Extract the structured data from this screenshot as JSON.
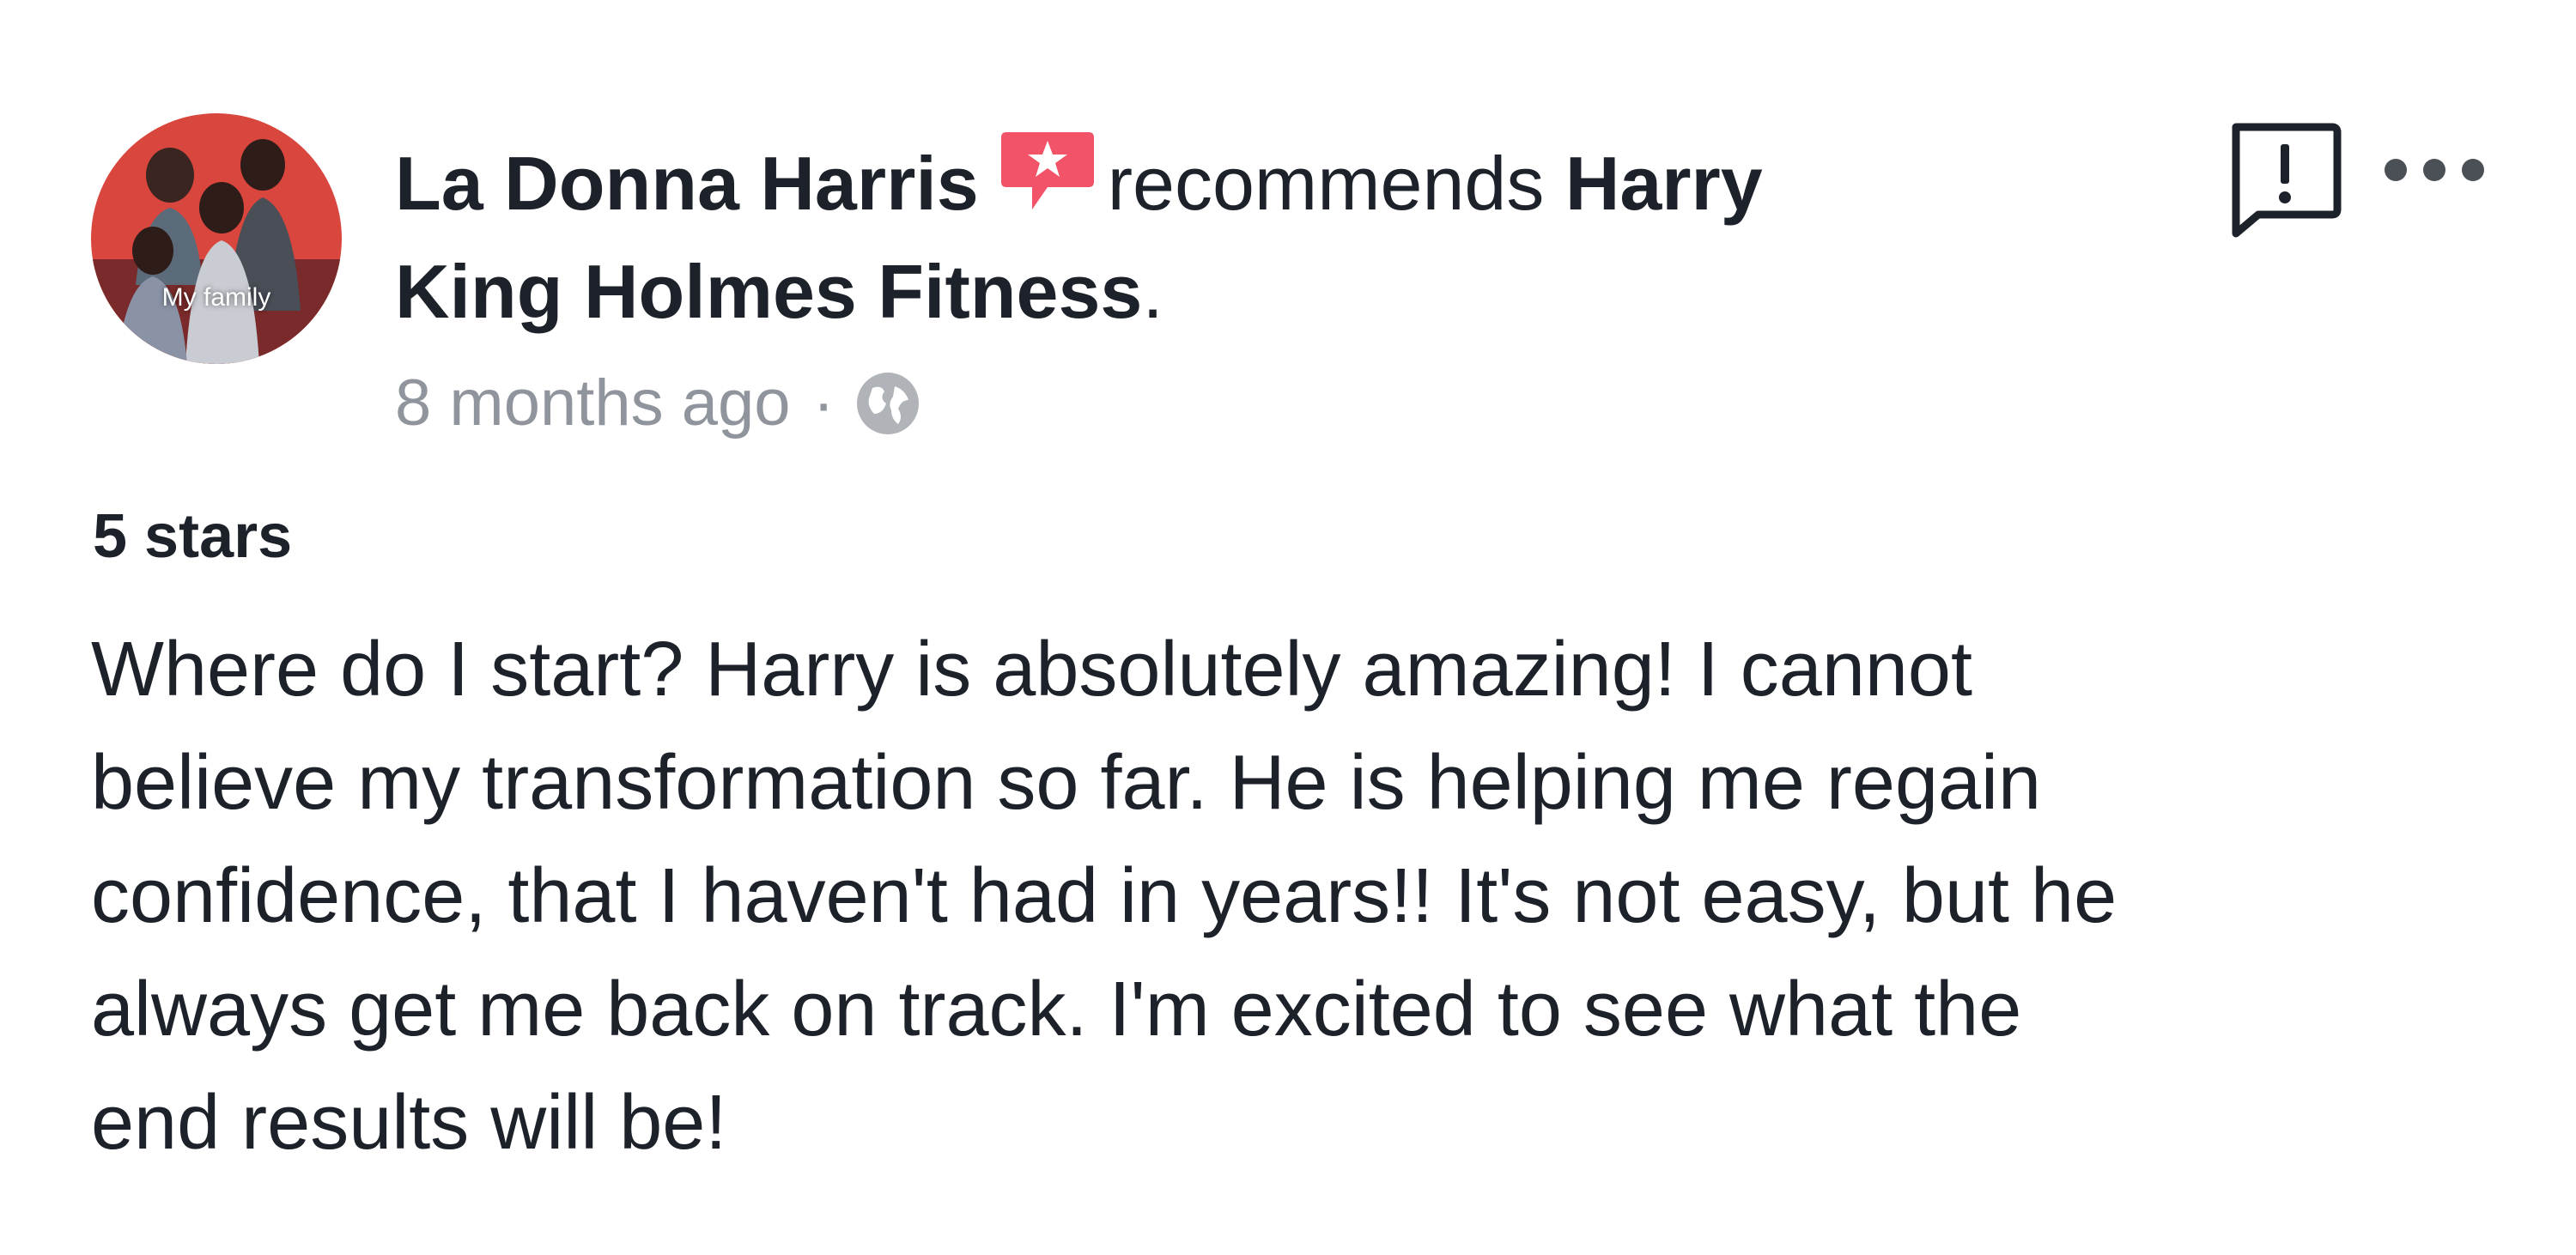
{
  "post": {
    "author": "La Donna Harris",
    "action": "recommends",
    "page_name_line1": "Harry",
    "page_name_line2": "King Holmes Fitness",
    "period": ".",
    "timestamp": "8 months ago",
    "separator": "·",
    "privacy_icon": "globe-icon",
    "recommend_icon": "recommendation-star-icon",
    "avatar_caption": "My family",
    "rating": "5 stars",
    "review_lines": [
      "Where do I start? Harry is absolutely amazing! I cannot",
      "believe my transformation so far. He is helping me regain",
      "confidence, that I haven't had in years!! It's not easy, but he",
      "always get me back on track. I'm excited to see what the",
      "end results will be!"
    ]
  },
  "actions": {
    "report_icon": "report-icon",
    "more_icon": "more-options-icon"
  },
  "colors": {
    "text": "#1d2129",
    "secondary_text": "#90949c",
    "recommend_accent": "#f35369",
    "avatar_background": "#d9463e"
  }
}
